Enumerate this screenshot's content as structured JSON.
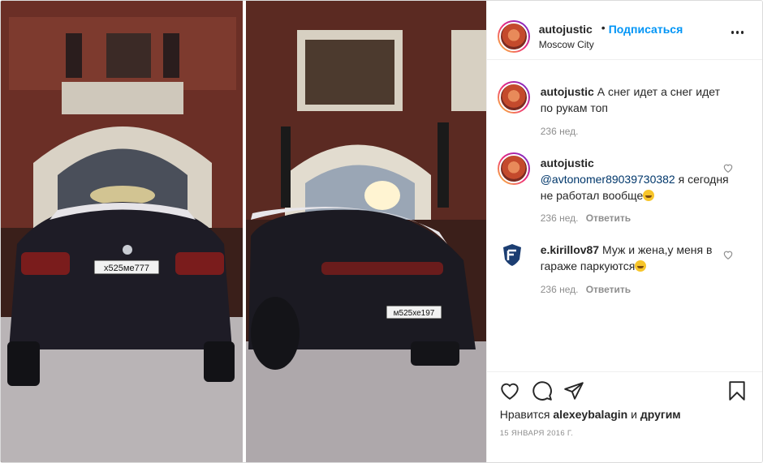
{
  "header": {
    "username": "autojustic",
    "separator": "•",
    "follow_label": "Подписаться",
    "location": "Moscow City"
  },
  "photo": {
    "left_plate": "х525ме777",
    "right_plate": "м525хе197"
  },
  "comments": [
    {
      "username": "autojustic",
      "text": "А снег идет а снег идет по рукам топ",
      "time": "236 нед."
    },
    {
      "username": "autojustic",
      "mention": "@avtonomer89039730382",
      "text": "я сегодня не работал вообще",
      "emoji": "laughing-face",
      "time": "236 нед.",
      "reply_label": "Ответить"
    },
    {
      "username": "e.kirillov87",
      "text": "Муж и жена,у меня в гараже паркуются",
      "emoji": "smiling-face",
      "time": "236 нед.",
      "reply_label": "Ответить"
    }
  ],
  "likes": {
    "prefix": "Нравится",
    "user": "alexeybalagin",
    "connector": "и",
    "others": "другим"
  },
  "date": "15 ЯНВАРЯ 2016 Г.",
  "colors": {
    "link_blue": "#0095f6",
    "mention_blue": "#00376b",
    "muted": "#8e8e8e"
  }
}
